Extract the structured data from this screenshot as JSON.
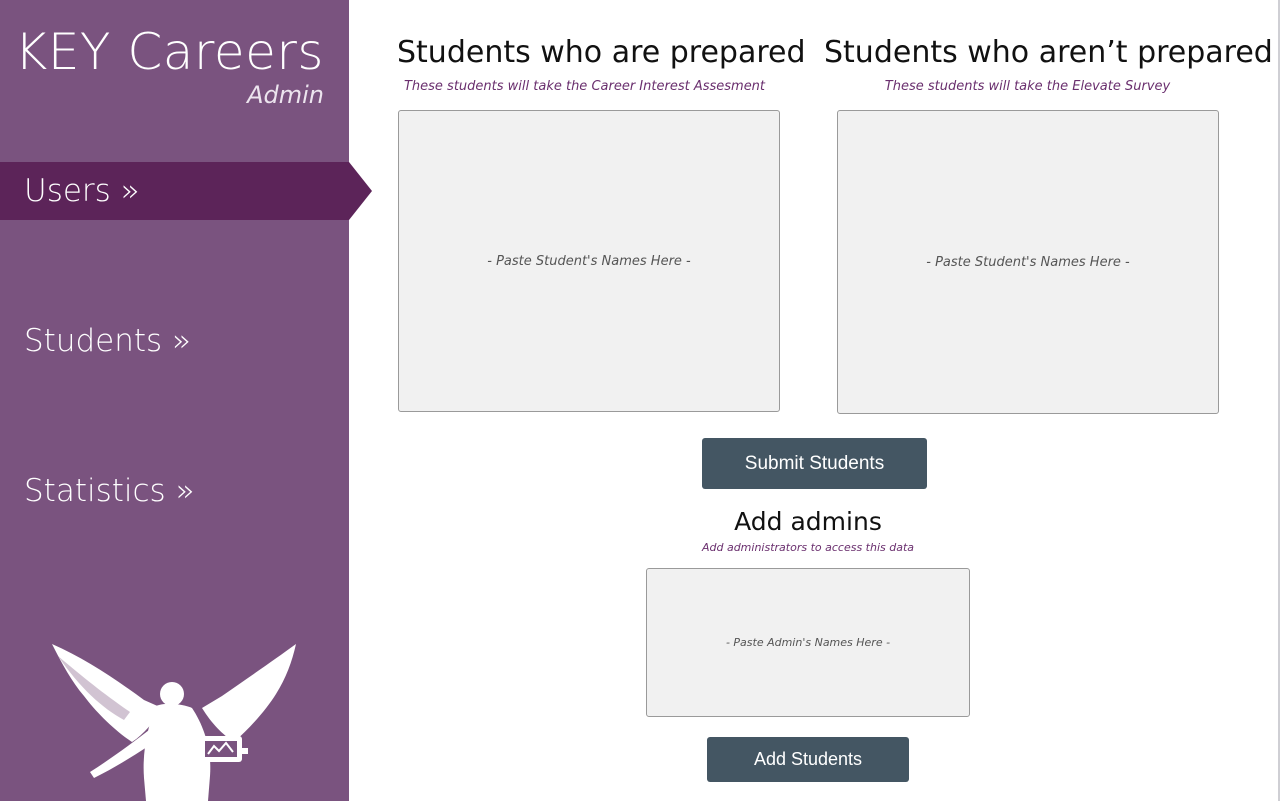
{
  "brand": {
    "title": "KEY Careers",
    "subtitle": "Admin"
  },
  "nav": {
    "users": "Users »",
    "students": "Students »",
    "statistics": "Statistics »"
  },
  "prepared": {
    "title": "Students who are prepared",
    "subtitle": "These students will take the Career Interest Assesment",
    "placeholder": "- Paste Student's Names Here -"
  },
  "not_prepared": {
    "title": "Students who aren’t prepared",
    "subtitle": "These students will take the Elevate Survey",
    "placeholder": "- Paste Student's Names Here -"
  },
  "submit_label": "Submit Students",
  "admins": {
    "title": "Add admins",
    "subtitle": "Add administrators to access this data",
    "placeholder": "- Paste Admin's Names Here -",
    "button_label": "Add Students"
  },
  "colors": {
    "sidebar": "#7a537f",
    "active_nav": "#5c2459",
    "button": "#445663",
    "subtitle_text": "#6a2f6e"
  },
  "icons": {
    "emblem": "winged-statue-logo"
  }
}
